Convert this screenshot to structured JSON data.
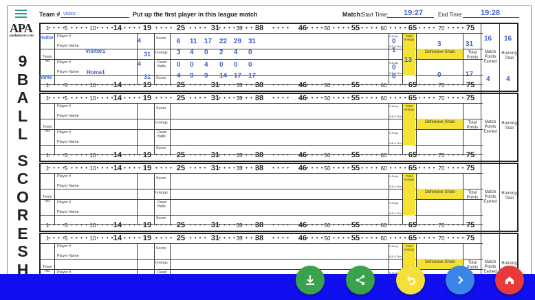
{
  "header": {
    "team_label": "Team #",
    "team_value": "visitor",
    "instruction": "Put up the first player in this league match",
    "match_label": "Match:",
    "start_label": "Start Time:",
    "start_value": "19:27",
    "end_label": "End Time:",
    "end_value": "19:28"
  },
  "logo": {
    "text": "APA",
    "site": "poolplayers.com"
  },
  "vertical_title": [
    "9",
    "B",
    "A",
    "L",
    "L",
    "",
    "S",
    "C",
    "O",
    "R",
    "E",
    "S",
    "H"
  ],
  "ruler": {
    "labels": [
      "1",
      "5",
      "10",
      "14",
      "19",
      "25",
      "31",
      "35",
      "38",
      "46",
      "50",
      "55",
      "60",
      "65",
      "70",
      "75"
    ]
  },
  "labels": {
    "player_num": "Player #",
    "player_name": "Player Name",
    "team": "Team",
    "no": "No.",
    "skill": "Skill Level",
    "ball_count": "Ball Count",
    "score": "Score",
    "innings": "Innings",
    "dead_balls": "Dead Balls",
    "nine_snap": "9-Snap",
    "nine_run": "9-B & Run",
    "total_innings": "Total Innings",
    "defensive_shots": "Defensive Shots",
    "total_points": "Total Points",
    "match_points": "Match Points Earned",
    "running_total": "Running Total"
  },
  "match1": {
    "visitor_team": "visitor",
    "home_team": "home",
    "visitor_name": "Visitor1",
    "home_name": "Home1",
    "visitor_skill": "4",
    "visitor_count": "31",
    "home_skill": "4",
    "home_count": "31",
    "visitor_scores": [
      "6",
      "11",
      "17",
      "22",
      "29",
      "31"
    ],
    "innings": [
      "3",
      "4",
      "0",
      "2",
      "4",
      "0"
    ],
    "dead_balls": [
      "0",
      "0",
      "4",
      "0",
      "0",
      "0"
    ],
    "home_scores": [
      "4",
      "9",
      "9",
      "14",
      "17",
      "17"
    ],
    "visitor_snap": "0",
    "visitor_run": "1",
    "home_snap": "0",
    "home_run": "0",
    "total_innings": "13",
    "visitor_def": "3",
    "home_def": "0",
    "visitor_total": "31",
    "home_total": "17",
    "visitor_match_pts": "16",
    "visitor_running": "16",
    "home_match_pts": "4",
    "home_running": "4"
  },
  "fabs": [
    {
      "name": "download-button",
      "color": "#3aa24a",
      "icon": "download-icon"
    },
    {
      "name": "share-button",
      "color": "#3aa24a",
      "icon": "share-icon"
    },
    {
      "name": "undo-button",
      "color": "#f3e03a",
      "icon": "undo-icon"
    },
    {
      "name": "next-button",
      "color": "#3a86e8",
      "icon": "chevron-right-icon"
    },
    {
      "name": "home-button",
      "color": "#e83a3a",
      "icon": "home-icon"
    }
  ]
}
